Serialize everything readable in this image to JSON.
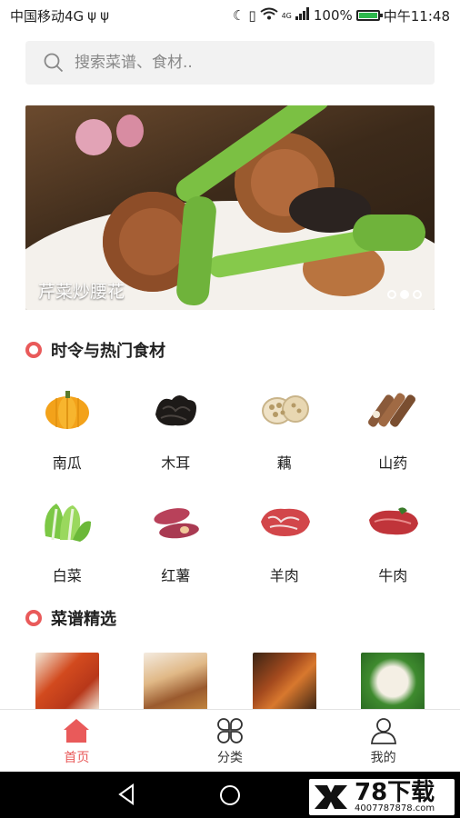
{
  "status_bar": {
    "carrier": "中国移动4G",
    "usb1": "ψ",
    "usb2": "ψ",
    "battery_pct": "100%",
    "time": "中午11:48",
    "network": "4G"
  },
  "search": {
    "placeholder": "搜索菜谱、食材.."
  },
  "banner": {
    "caption": "芹菜炒腰花",
    "page_count": 3,
    "active_page": 2
  },
  "seasonal": {
    "title": "时令与热门食材",
    "items": [
      {
        "label": "南瓜",
        "icon": "pumpkin-icon"
      },
      {
        "label": "木耳",
        "icon": "wood-ear-icon"
      },
      {
        "label": "藕",
        "icon": "lotus-root-icon"
      },
      {
        "label": "山药",
        "icon": "yam-icon"
      },
      {
        "label": "白菜",
        "icon": "cabbage-icon"
      },
      {
        "label": "红薯",
        "icon": "sweet-potato-icon"
      },
      {
        "label": "羊肉",
        "icon": "mutton-icon"
      },
      {
        "label": "牛肉",
        "icon": "beef-icon"
      }
    ]
  },
  "recipes": {
    "title": "菜谱精选"
  },
  "tabbar": {
    "home": "首页",
    "category": "分类",
    "mine": "我的"
  },
  "watermark": {
    "brand": "78下载",
    "phone": "4007787878.com"
  },
  "colors": {
    "accent": "#e95a5a"
  }
}
